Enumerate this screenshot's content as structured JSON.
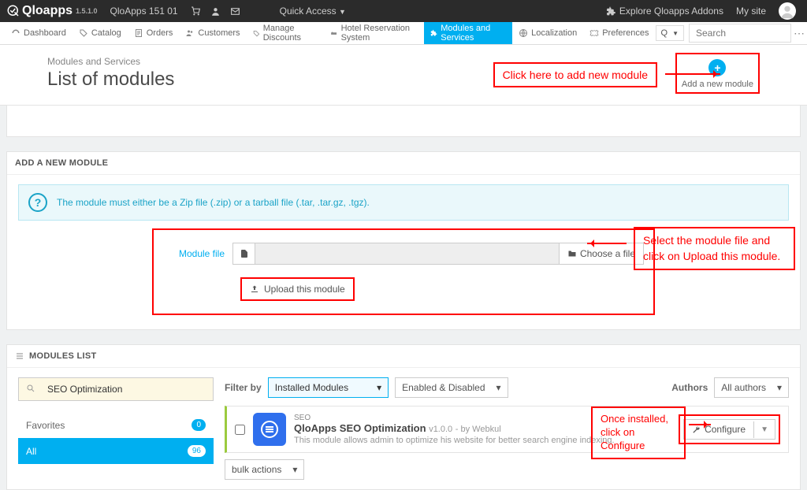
{
  "topbar": {
    "brand": "Qloapps",
    "version": "1.5.1.0",
    "site_name": "QloApps 151 01",
    "quick_access": "Quick Access",
    "explore": "Explore Qloapps Addons",
    "my_site": "My site"
  },
  "menu": {
    "items": [
      "Dashboard",
      "Catalog",
      "Orders",
      "Customers",
      "Manage Discounts",
      "Hotel Reservation System",
      "Modules and Services",
      "Localization",
      "Preferences"
    ],
    "active_index": 6,
    "search_placeholder": "Search",
    "lang": "Q"
  },
  "page": {
    "breadcrumb": "Modules and Services",
    "title": "List of modules",
    "add_button": "Add a new module"
  },
  "annotations": {
    "add_module": "Click here to add new module",
    "select_upload": "Select the module file and click on Upload this module.",
    "configure": "Once installed, click on Configure"
  },
  "add_panel": {
    "heading": "ADD A NEW MODULE",
    "info": "The module must either be a Zip file (.zip) or a tarball file (.tar, .tar.gz, .tgz).",
    "file_label": "Module file",
    "choose": "Choose a file",
    "upload": "Upload this module"
  },
  "modules_list": {
    "heading": "MODULES LIST",
    "search_value": "SEO Optimization",
    "categories": {
      "favorites": {
        "label": "Favorites",
        "count": "0"
      },
      "all": {
        "label": "All",
        "count": "96"
      }
    },
    "filter_label": "Filter by",
    "filter_installed": "Installed Modules",
    "filter_enabled": "Enabled & Disabled",
    "authors_label": "Authors",
    "authors_value": "All authors",
    "bulk": "bulk actions",
    "module": {
      "category": "SEO",
      "name": "QloApps SEO Optimization",
      "version": "v1.0.0",
      "by": "- by Webkul",
      "desc": "This module allows admin to optimize his website for better search engine indexing.",
      "configure": "Configure"
    }
  }
}
